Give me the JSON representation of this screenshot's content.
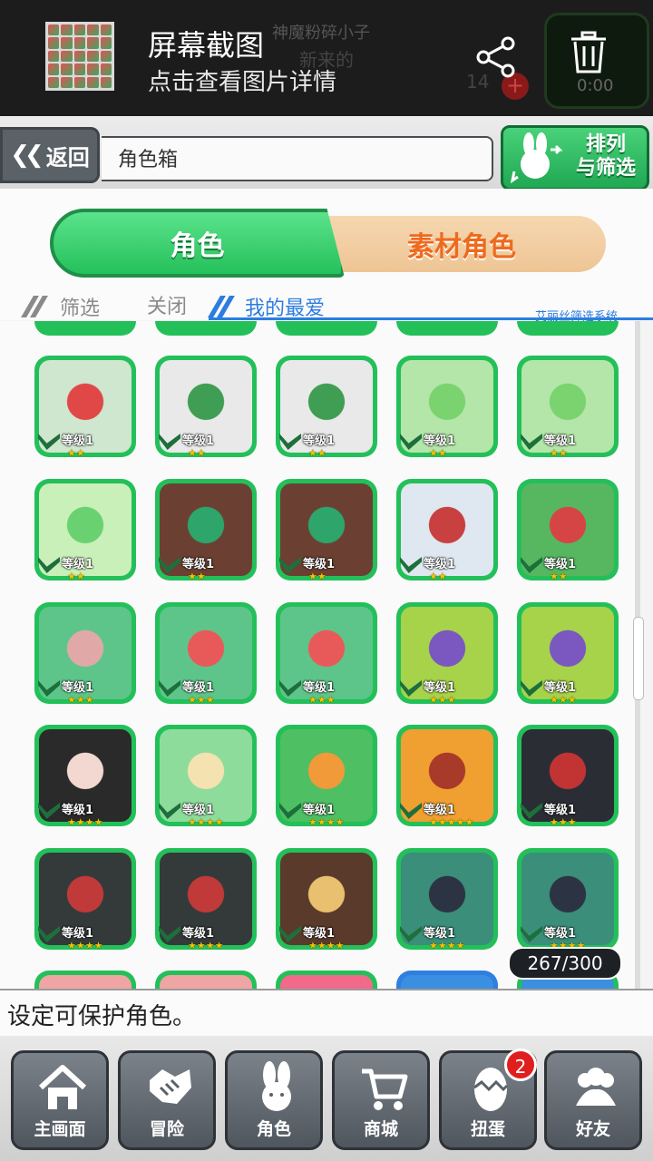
{
  "screenshot_banner": {
    "title": "屏幕截图",
    "subtitle": "点击查看图片详情",
    "share_icon": "share-icon",
    "delete_icon": "trash-icon"
  },
  "background_game": {
    "player_title": "神魔粉碎小子",
    "player_name": "新来的",
    "stamina": "14",
    "timer": "0:00"
  },
  "header": {
    "back_label": "返回",
    "page_title": "角色箱",
    "sort_label_1": "排列",
    "sort_label_2": "与筛选"
  },
  "tabs": [
    {
      "label": "角色",
      "active": true
    },
    {
      "label": "素材角色",
      "active": false
    }
  ],
  "filter": {
    "label": "筛选",
    "close": "关闭",
    "favorites": "我的最爱",
    "system": "艾丽丝筛选系统"
  },
  "characters": [
    {
      "level": "等级1",
      "stars": 2,
      "palette": [
        "#cfe6cf",
        "#e04848"
      ]
    },
    {
      "level": "等级1",
      "stars": 2,
      "palette": [
        "#e9e9e9",
        "#3f9e53"
      ]
    },
    {
      "level": "等级1",
      "stars": 2,
      "palette": [
        "#e9e9e9",
        "#3f9e53"
      ]
    },
    {
      "level": "等级1",
      "stars": 2,
      "palette": [
        "#b3e6a8",
        "#7ad36f"
      ]
    },
    {
      "level": "等级1",
      "stars": 2,
      "palette": [
        "#b3e6a8",
        "#7ad36f"
      ]
    },
    {
      "level": "等级1",
      "stars": 2,
      "palette": [
        "#c9f0b8",
        "#6ad171"
      ]
    },
    {
      "level": "等级1",
      "stars": 2,
      "palette": [
        "#6b4032",
        "#2da56b"
      ]
    },
    {
      "level": "等级1",
      "stars": 2,
      "palette": [
        "#6b4032",
        "#2da56b"
      ]
    },
    {
      "level": "等级1",
      "stars": 2,
      "palette": [
        "#dfe7f0",
        "#c84040"
      ]
    },
    {
      "level": "等级1",
      "stars": 2,
      "palette": [
        "#56b760",
        "#d64545"
      ]
    },
    {
      "level": "等级1",
      "stars": 3,
      "palette": [
        "#5ec58a",
        "#e1a8a8"
      ]
    },
    {
      "level": "等级1",
      "stars": 3,
      "palette": [
        "#5ec58a",
        "#e85a5a"
      ]
    },
    {
      "level": "等级1",
      "stars": 3,
      "palette": [
        "#5ec58a",
        "#e85a5a"
      ]
    },
    {
      "level": "等级1",
      "stars": 3,
      "palette": [
        "#a7d34a",
        "#7a58c0"
      ]
    },
    {
      "level": "等级1",
      "stars": 3,
      "palette": [
        "#a7d34a",
        "#7a58c0"
      ]
    },
    {
      "level": "等级1",
      "stars": 4,
      "palette": [
        "#2a2a2a",
        "#f2d8d0"
      ]
    },
    {
      "level": "等级1",
      "stars": 4,
      "palette": [
        "#8edc9b",
        "#f4e2b0"
      ]
    },
    {
      "level": "等级1",
      "stars": 4,
      "palette": [
        "#4ebf62",
        "#f09a3a"
      ]
    },
    {
      "level": "等级1",
      "stars": 5,
      "palette": [
        "#f0a030",
        "#a83a2a"
      ]
    },
    {
      "level": "等级1",
      "stars": 3,
      "palette": [
        "#2b2d35",
        "#c23434"
      ]
    },
    {
      "level": "等级1",
      "stars": 4,
      "palette": [
        "#343a3a",
        "#c03a3a"
      ]
    },
    {
      "level": "等级1",
      "stars": 4,
      "palette": [
        "#343a3a",
        "#c03a3a"
      ]
    },
    {
      "level": "等级1",
      "stars": 4,
      "palette": [
        "#5a3a2a",
        "#e8c070"
      ]
    },
    {
      "level": "等级1",
      "stars": 4,
      "palette": [
        "#3a8e7a",
        "#2c3444"
      ]
    },
    {
      "level": "等级1",
      "stars": 4,
      "palette": [
        "#3a8e7a",
        "#2c3444"
      ]
    }
  ],
  "box_count": "267/300",
  "info_text": "设定可保护角色。",
  "nav": [
    {
      "label": "主画面",
      "icon": "home-icon"
    },
    {
      "label": "冒险",
      "icon": "handshake-icon"
    },
    {
      "label": "角色",
      "icon": "rabbit-icon"
    },
    {
      "label": "商城",
      "icon": "cart-icon"
    },
    {
      "label": "扭蛋",
      "icon": "egg-icon",
      "badge": "2"
    },
    {
      "label": "好友",
      "icon": "friends-icon"
    }
  ]
}
